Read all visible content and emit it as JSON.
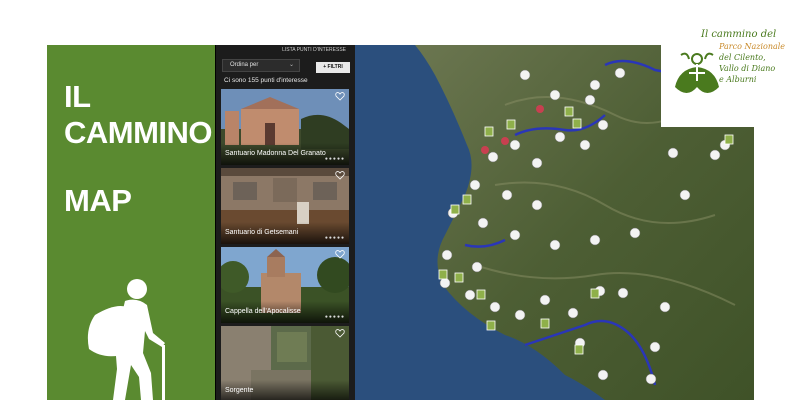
{
  "slide": {
    "title_line1": "IL",
    "title_line2": "CAMMINO",
    "title_line3": "MAP",
    "green": "#5a8a30"
  },
  "list": {
    "header": "LISTA PUNTI D'INTERESSE",
    "sort_label": "Ordina per",
    "filter_label": "+ FILTRI",
    "count_text": "Ci sono 155 punti d'interesse",
    "close_label": "×",
    "items": [
      {
        "label": "Santuario Madonna Del Granato",
        "rating": "●●●●●"
      },
      {
        "label": "Santuario di Getsemani",
        "rating": "●●●●●"
      },
      {
        "label": "Cappella dell'Apocalisse",
        "rating": "●●●●●"
      },
      {
        "label": "Sorgente",
        "rating": ""
      }
    ]
  },
  "logo": {
    "line1": "Il cammino del",
    "line2": "Parco Nazionale",
    "line3": "del Cilento,",
    "line4": "Vallo di Diano",
    "line5": "e Alburni",
    "line6": "",
    "green": "#4a7a1e",
    "orange": "#c98a2a"
  },
  "map": {
    "sea_color": "#2b4f7d",
    "route_color": "#2a36b8"
  }
}
